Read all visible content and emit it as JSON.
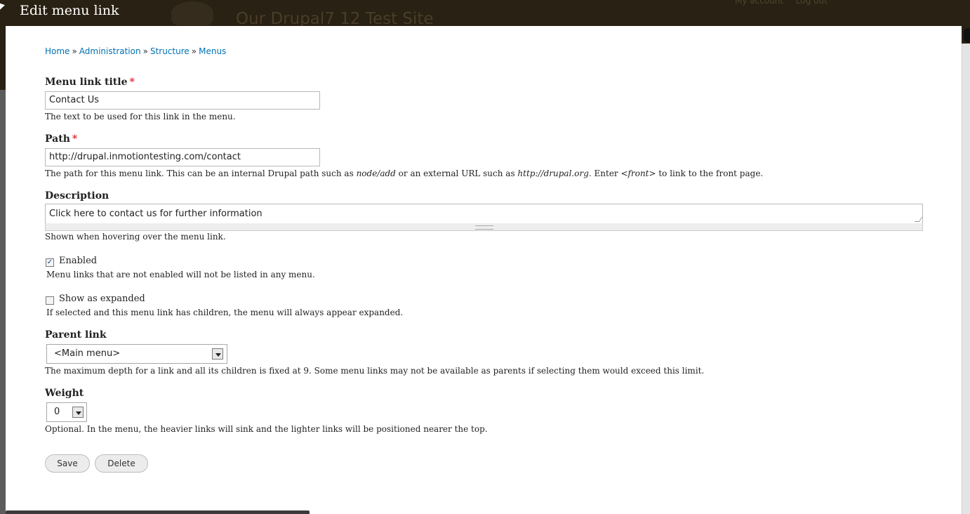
{
  "site": {
    "name": "Our Drupal7 12 Test Site",
    "user_links": [
      "My account",
      "Log out"
    ]
  },
  "overlay": {
    "title": "Edit menu link"
  },
  "breadcrumb": [
    "Home",
    "Administration",
    "Structure",
    "Menus"
  ],
  "breadcrumb_separator": "»",
  "required_marker": "*",
  "form": {
    "title": {
      "label": "Menu link title",
      "value": "Contact Us",
      "description": "The text to be used for this link in the menu."
    },
    "path": {
      "label": "Path",
      "value": "http://drupal.inmotiontesting.com/contact",
      "description_parts": [
        "The path for this menu link. This can be an internal Drupal path such as ",
        "node/add",
        " or an external URL such as ",
        "http://drupal.org",
        ". Enter ",
        "<front>",
        " to link to the front page."
      ]
    },
    "description": {
      "label": "Description",
      "value": "Click here to contact us for further information",
      "help": "Shown when hovering over the menu link."
    },
    "enabled": {
      "label": "Enabled",
      "checked": true,
      "mark": "✓",
      "description": "Menu links that are not enabled will not be listed in any menu."
    },
    "expanded": {
      "label": "Show as expanded",
      "checked": false,
      "description": "If selected and this menu link has children, the menu will always appear expanded."
    },
    "parent": {
      "label": "Parent link",
      "selected": "<Main menu>",
      "description": "The maximum depth for a link and all its children is fixed at 9. Some menu links may not be available as parents if selecting them would exceed this limit."
    },
    "weight": {
      "label": "Weight",
      "selected": "0",
      "description": "Optional. In the menu, the heavier links will sink and the lighter links will be positioned nearer the top."
    }
  },
  "actions": {
    "save": "Save",
    "delete": "Delete"
  },
  "colors": {
    "link": "#0071b3",
    "required": "#e0252b",
    "header_bg": "#292113",
    "panel_bg": "#ffffff"
  }
}
